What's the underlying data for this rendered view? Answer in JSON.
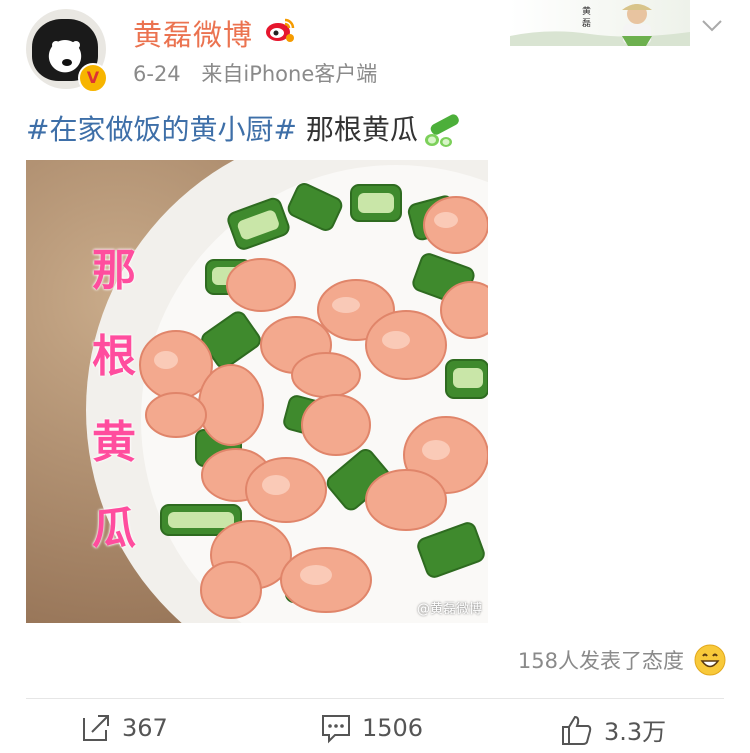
{
  "user": {
    "name": "黄磊微博",
    "verified_badge": "V",
    "date": "6-24",
    "source": "来自iPhone客户端"
  },
  "banner": {
    "text": "黄磊"
  },
  "post": {
    "hashtag": "#在家做饭的黄小厨#",
    "text": " 那根黄瓜",
    "emoji": "cucumber-emoji"
  },
  "image": {
    "vertical_title": [
      "那",
      "根",
      "黄",
      "瓜"
    ],
    "watermark": "@黄磊微博"
  },
  "reactions": {
    "text": "158人发表了态度",
    "emoji": "grinning-face-icon"
  },
  "actions": {
    "repost_count": "367",
    "comment_count": "1506",
    "like_count": "3.3万"
  },
  "colors": {
    "username": "#eb7350",
    "hashtag": "#3e6fa8",
    "meta": "#8a8a8a",
    "vertical_title": "#ff4d9e"
  }
}
